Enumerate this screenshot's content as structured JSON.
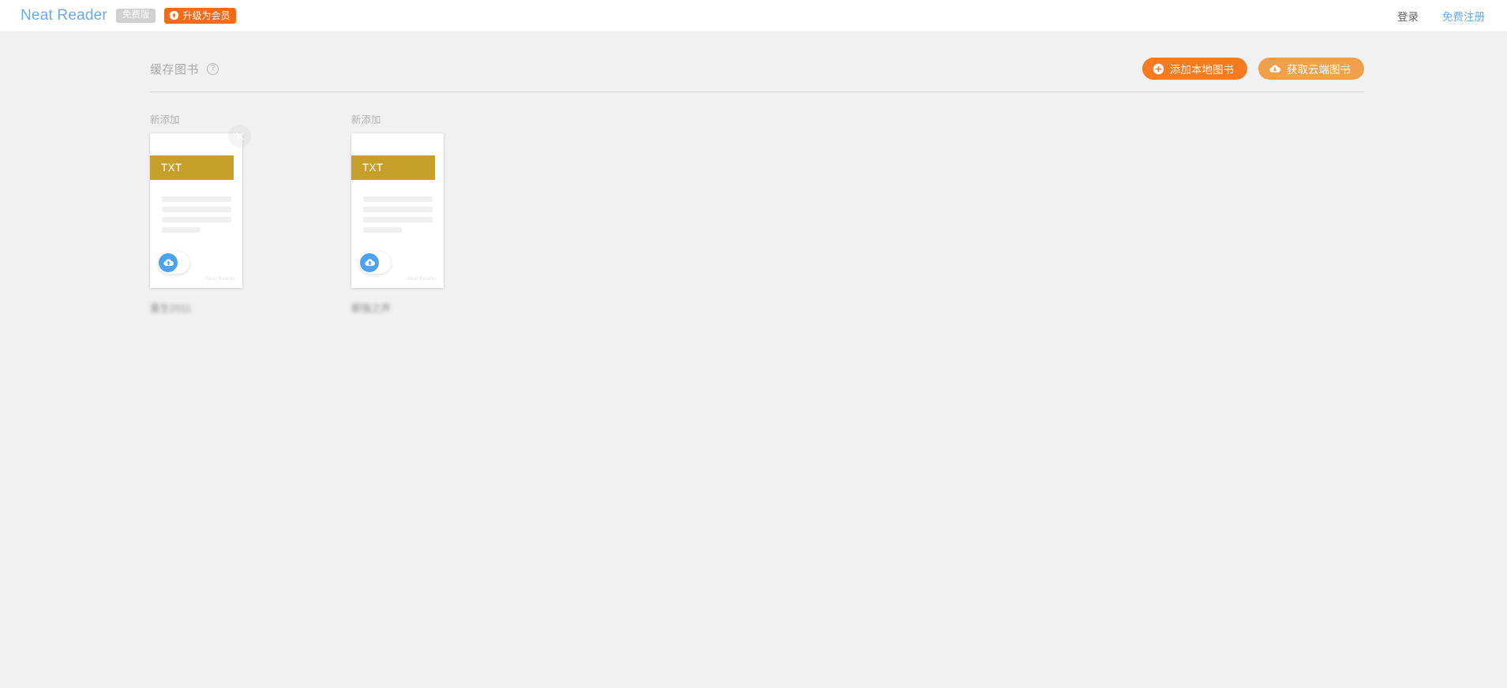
{
  "header": {
    "brand": "Neat Reader",
    "free_badge": "免费版",
    "upgrade_badge": "升级为会员",
    "upgrade_icon": "arrow-up-circle-icon",
    "login_label": "登录",
    "register_label": "免费注册",
    "brand_color": "#6fa8e8",
    "upgrade_color": "#f26a1b"
  },
  "section": {
    "title": "缓存图书",
    "help_icon": "question-mark-icon",
    "add_local_label": "添加本地图书",
    "add_local_icon": "plus-circle-icon",
    "get_cloud_label": "获取云端图书",
    "get_cloud_icon": "cloud-download-icon",
    "primary_color": "#f47b20",
    "secondary_color": "#f0a04b"
  },
  "books": [
    {
      "slot_label": "新添加",
      "format": "TXT",
      "format_color": "#c6a02a",
      "watermark": "Neat Reader",
      "upload_icon": "cloud-upload-icon",
      "close_icon": "close-icon",
      "has_close": true,
      "title": "重生2011"
    },
    {
      "slot_label": "新添加",
      "format": "TXT",
      "format_color": "#c6a02a",
      "watermark": "Neat Reader",
      "upload_icon": "cloud-upload-icon",
      "close_icon": "close-icon",
      "has_close": false,
      "title": "都强之声"
    }
  ]
}
